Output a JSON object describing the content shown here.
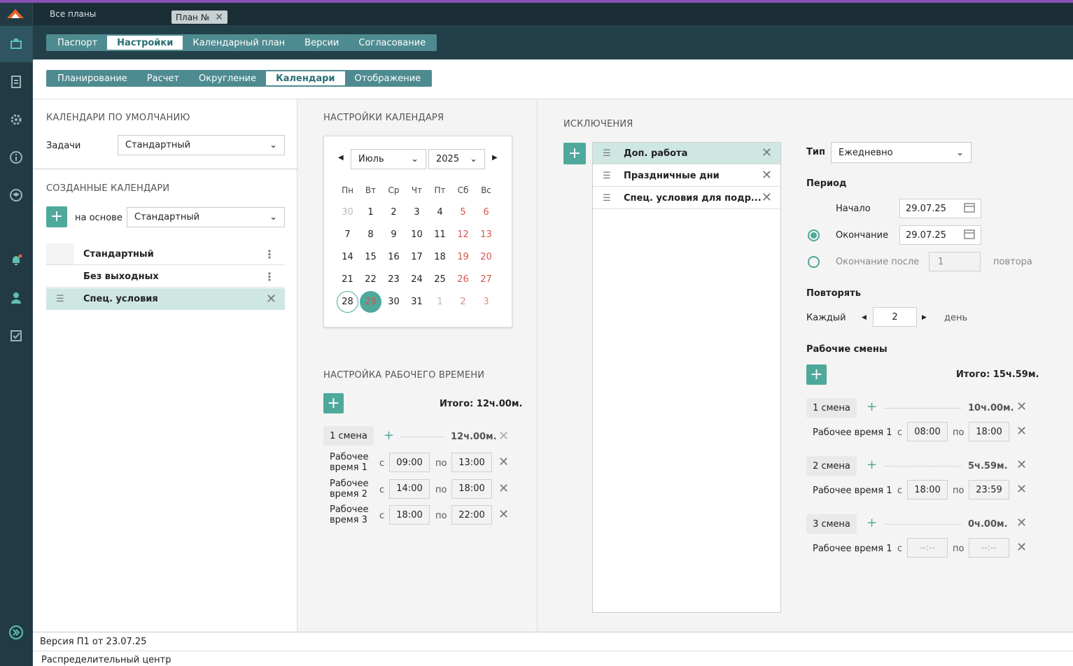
{
  "header": {
    "all_plans": "Все планы",
    "plan_tab": "План №"
  },
  "main_tabs": [
    "Паспорт",
    "Настройки",
    "Календарный план",
    "Версии",
    "Согласование"
  ],
  "sub_tabs": [
    "Планирование",
    "Расчет",
    "Округление",
    "Календари",
    "Отображение"
  ],
  "defaults": {
    "title": "КАЛЕНДАРИ ПО УМОЛЧАНИЮ",
    "tasks_label": "Задачи",
    "tasks_value": "Стандартный"
  },
  "created": {
    "title": "СОЗДАННЫЕ КАЛЕНДАРИ",
    "based_label": "на основе",
    "based_value": "Стандартный",
    "items": [
      "Стандартный",
      "Без выходных",
      "Спец. условия"
    ]
  },
  "calendar": {
    "title": "НАСТРОЙКИ КАЛЕНДАРЯ",
    "month": "Июль",
    "year": "2025",
    "weekdays": [
      "Пн",
      "Вт",
      "Ср",
      "Чт",
      "Пт",
      "Сб",
      "Вс"
    ],
    "weeks": [
      [
        "30",
        "1",
        "2",
        "3",
        "4",
        "5",
        "6"
      ],
      [
        "7",
        "8",
        "9",
        "10",
        "11",
        "12",
        "13"
      ],
      [
        "14",
        "15",
        "16",
        "17",
        "18",
        "19",
        "20"
      ],
      [
        "21",
        "22",
        "23",
        "24",
        "25",
        "26",
        "27"
      ],
      [
        "28",
        "29",
        "30",
        "31",
        "1",
        "2",
        "3"
      ]
    ]
  },
  "worktime": {
    "title": "НАСТРОЙКА РАБОЧЕГО ВРЕМЕНИ",
    "total": "Итого: 12ч.00м.",
    "shift": "1 смена",
    "shift_total": "12ч.00м.",
    "c": "с",
    "po": "по",
    "rows": [
      {
        "l1": "Рабочее",
        "l2": "время 1",
        "from": "09:00",
        "to": "13:00"
      },
      {
        "l1": "Рабочее",
        "l2": "время 2",
        "from": "14:00",
        "to": "18:00"
      },
      {
        "l1": "Рабочее",
        "l2": "время 3",
        "from": "18:00",
        "to": "22:00"
      }
    ]
  },
  "exceptions": {
    "title": "ИСКЛЮЧЕНИЯ",
    "items": [
      "Доп. работа",
      "Праздничные дни",
      "Спец. условия для подр..."
    ]
  },
  "detail": {
    "type_label": "Тип",
    "type_value": "Ежедневно",
    "period": "Период",
    "start_label": "Начало",
    "start": "29.07.25",
    "end_label": "Окончание",
    "end": "29.07.25",
    "after_label": "Окончание после",
    "after_value": "1",
    "repeats": "повтора",
    "repeat_title": "Повторять",
    "each": "Каждый",
    "each_value": "2",
    "day": "день",
    "shifts_title": "Рабочие смены",
    "total": "Итого: 15ч.59м.",
    "c": "с",
    "po": "по",
    "shifts": [
      {
        "name": "1 смена",
        "total": "10ч.00м.",
        "row": "Рабочее время 1",
        "from": "08:00",
        "to": "18:00"
      },
      {
        "name": "2 смена",
        "total": "5ч.59м.",
        "row": "Рабочее время 1",
        "from": "18:00",
        "to": "23:59"
      },
      {
        "name": "3 смена",
        "total": "0ч.00м.",
        "row": "Рабочее время 1",
        "from": "--:--",
        "to": "--:--"
      }
    ]
  },
  "footer": {
    "version": "Версия П1 от 23.07.25",
    "center": "Распределительный центр"
  },
  "colors": {
    "accent": "#4ea99b",
    "sidebar": "#213a44",
    "weekend": "#d9534f"
  }
}
